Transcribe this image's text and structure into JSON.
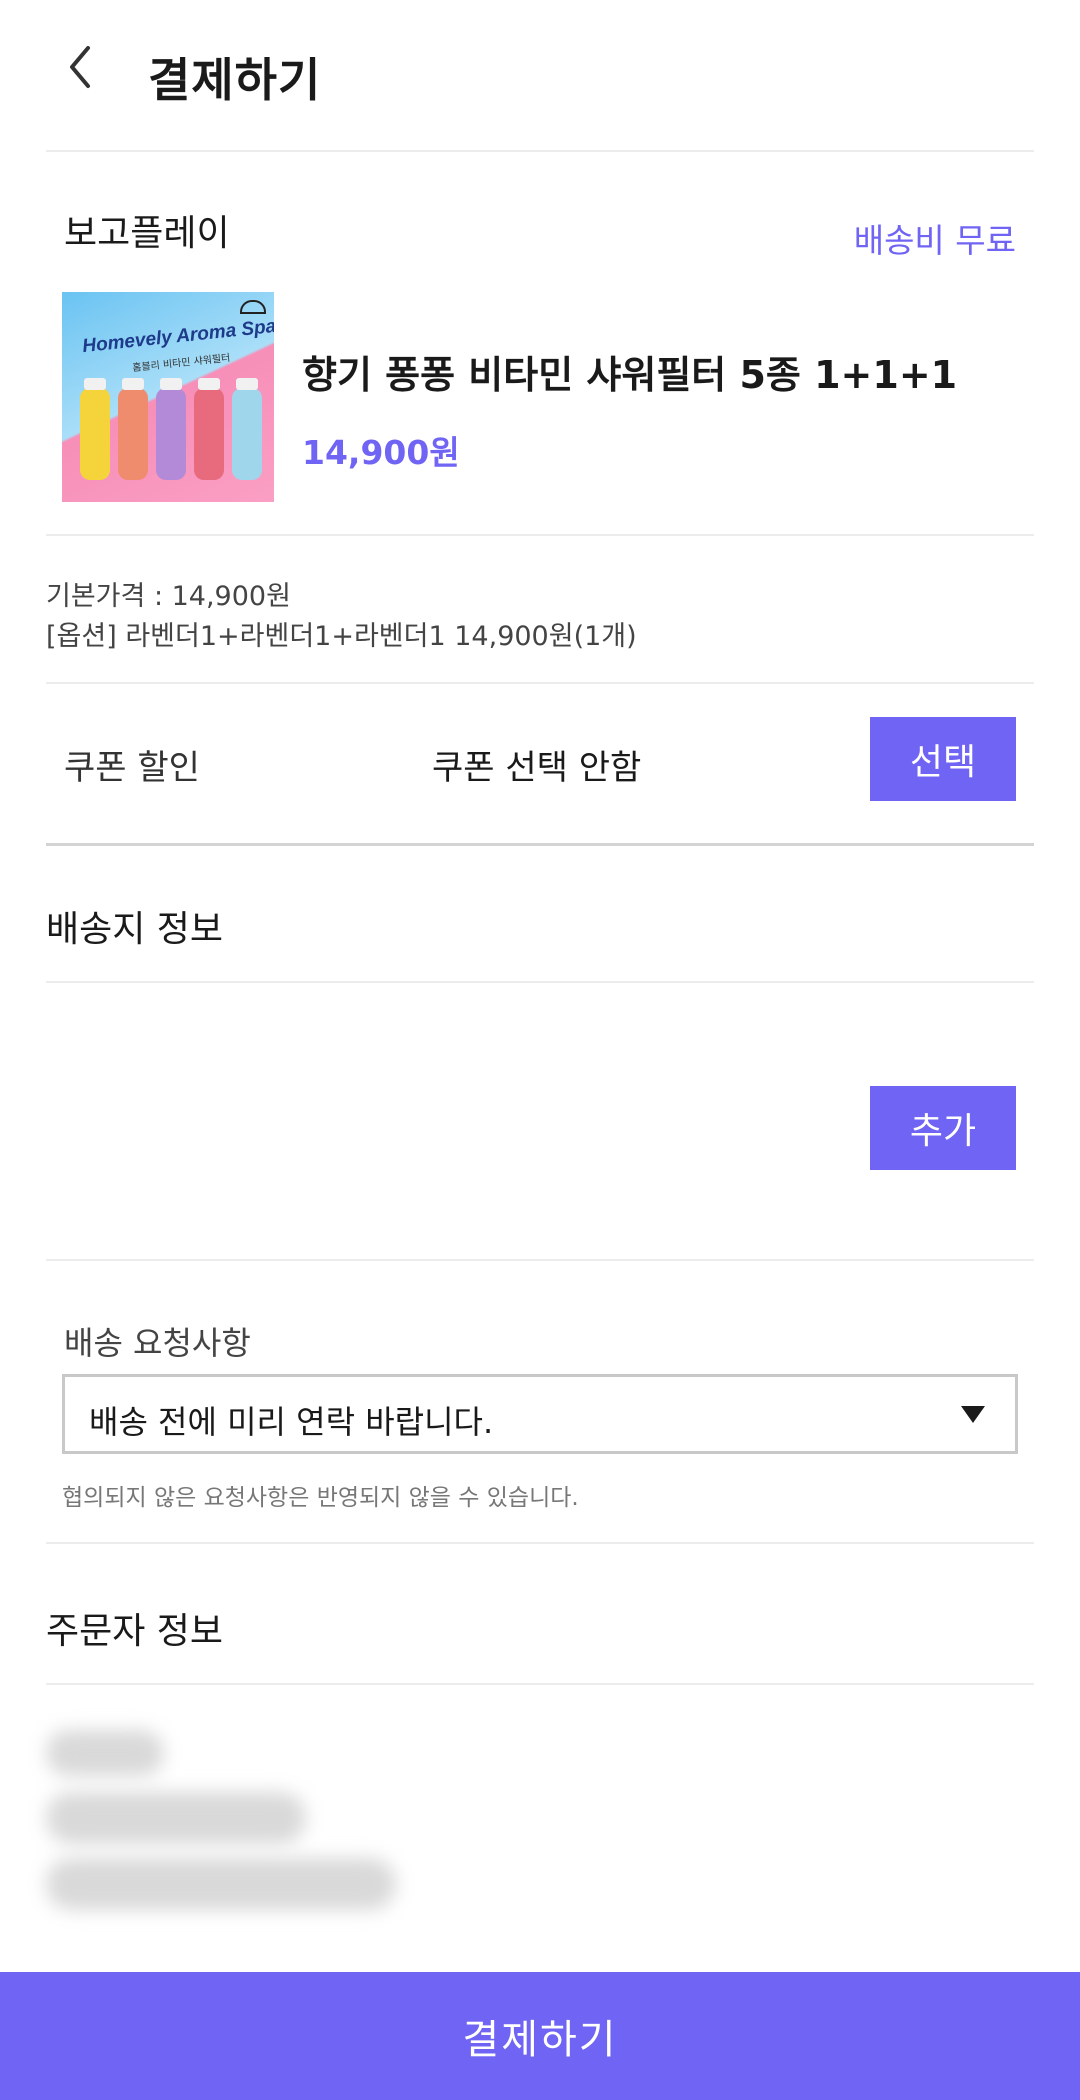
{
  "header": {
    "title": "결제하기",
    "back_icon": "chevron-left-icon"
  },
  "seller": {
    "name": "보고플레이",
    "shipping_fee": "배송비 무료"
  },
  "product": {
    "name": "향기 퐁퐁 비타민 샤워필터 5종 1+1+1",
    "price": "14,900원",
    "image_title": "Homevely Aroma Spa",
    "image_subtitle": "홈블리 비타민 샤워필터"
  },
  "price_detail": {
    "base": "기본가격 : 14,900원",
    "option": "[옵션] 라벤더1+라벤더1+라벤더1 14,900원(1개)"
  },
  "coupon": {
    "label": "쿠폰 할인",
    "value": "쿠폰 선택 안함",
    "button": "선택"
  },
  "shipping_address": {
    "title": "배송지 정보",
    "add_button": "추가"
  },
  "delivery_request": {
    "label": "배송 요청사항",
    "selected": "배송 전에 미리 연락 바랍니다.",
    "note": "협의되지 않은 요청사항은 반영되지 않을 수 있습니다.",
    "arrow_icon": "triangle-down-icon"
  },
  "orderer": {
    "title": "주문자 정보"
  },
  "pay_button": "결제하기",
  "colors": {
    "accent": "#7064f4",
    "divider": "#ececec"
  },
  "image_bottle_colors": [
    "#f5d33a",
    "#f08c6e",
    "#b38ad8",
    "#e86a7d",
    "#9fd6ec"
  ]
}
